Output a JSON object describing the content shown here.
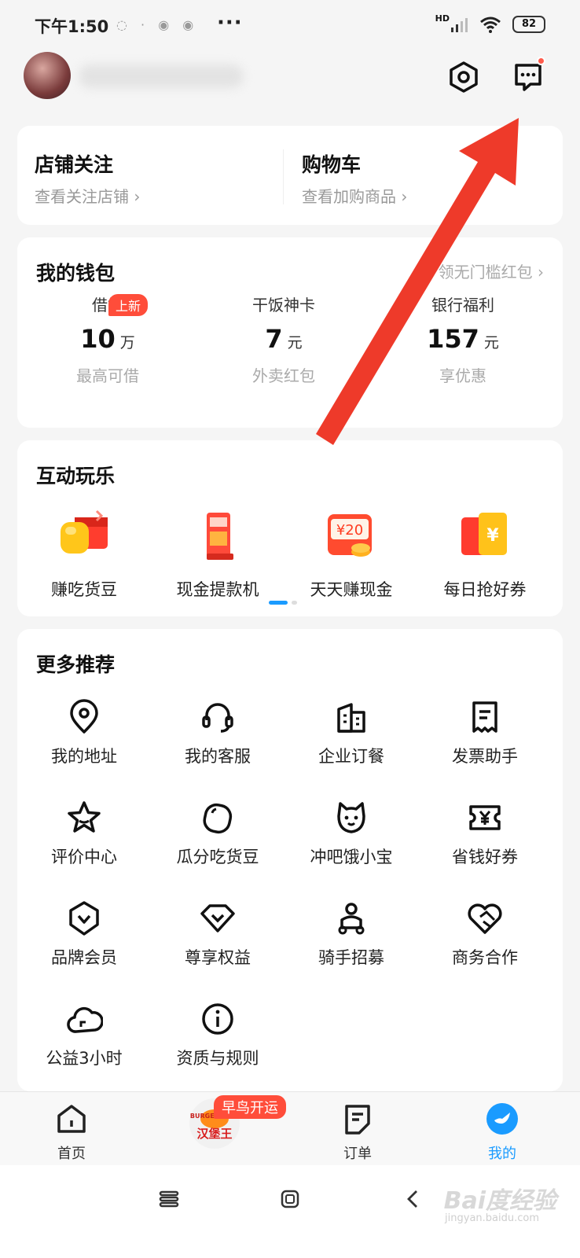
{
  "status_bar": {
    "time": "下午1:50",
    "battery": "82",
    "signal_label": "HD"
  },
  "header": {
    "username_blurred": true
  },
  "shop_section": [
    {
      "title": "店铺关注",
      "subtitle": "查看关注店铺 ›"
    },
    {
      "title": "购物车",
      "subtitle": "查看加购商品 ›"
    }
  ],
  "wallet": {
    "title": "我的钱包",
    "link": "领无门槛红包 ›",
    "items": [
      {
        "label": "借钱",
        "badge": "上新",
        "value": "10",
        "unit": "万",
        "sub": "最高可借"
      },
      {
        "label": "干饭神卡",
        "value": "7",
        "unit": "元",
        "sub": "外卖红包"
      },
      {
        "label": "银行福利",
        "value": "157",
        "unit": "元",
        "sub": "享优惠"
      }
    ]
  },
  "fun": {
    "title": "互动玩乐",
    "items": [
      {
        "label": "赚吃货豆",
        "icon": "bean-redpacket-icon"
      },
      {
        "label": "现金提款机",
        "icon": "cash-machine-icon"
      },
      {
        "label": "天天赚现金",
        "icon": "coupon-20-icon",
        "icon_text": "¥20"
      },
      {
        "label": "每日抢好券",
        "icon": "yen-ticket-icon",
        "icon_text": "¥"
      }
    ]
  },
  "more": {
    "title": "更多推荐",
    "items": [
      {
        "label": "我的地址",
        "icon": "location-pin-icon"
      },
      {
        "label": "我的客服",
        "icon": "headset-icon"
      },
      {
        "label": "企业订餐",
        "icon": "building-icon"
      },
      {
        "label": "发票助手",
        "icon": "receipt-icon"
      },
      {
        "label": "评价中心",
        "icon": "star-icon"
      },
      {
        "label": "瓜分吃货豆",
        "icon": "bean-icon"
      },
      {
        "label": "冲吧饿小宝",
        "icon": "cat-face-icon"
      },
      {
        "label": "省钱好券",
        "icon": "yen-coupon-icon"
      },
      {
        "label": "品牌会员",
        "icon": "vip-shield-icon"
      },
      {
        "label": "尊享权益",
        "icon": "heart-badge-icon"
      },
      {
        "label": "骑手招募",
        "icon": "rider-icon"
      },
      {
        "label": "商务合作",
        "icon": "handshake-icon"
      },
      {
        "label": "公益3小时",
        "icon": "cloud-icon"
      },
      {
        "label": "资质与规则",
        "icon": "info-icon"
      }
    ]
  },
  "tabbar": {
    "items": [
      {
        "label": "首页",
        "icon": "home-icon"
      },
      {
        "label": "汉堡王",
        "icon": "burger-king-logo",
        "badge": "早鸟开运",
        "logo_text": "BURGER KING"
      },
      {
        "label": "订单",
        "icon": "order-icon"
      },
      {
        "label": "我的",
        "icon": "profile-icon",
        "active": true
      }
    ]
  },
  "watermark": {
    "text": "Bai度经验",
    "sub": "jingyan.baidu.com"
  },
  "colors": {
    "accent_blue": "#1a9bff",
    "badge_red": "#ff4d3a",
    "arrow_red": "#ee3a2a"
  }
}
